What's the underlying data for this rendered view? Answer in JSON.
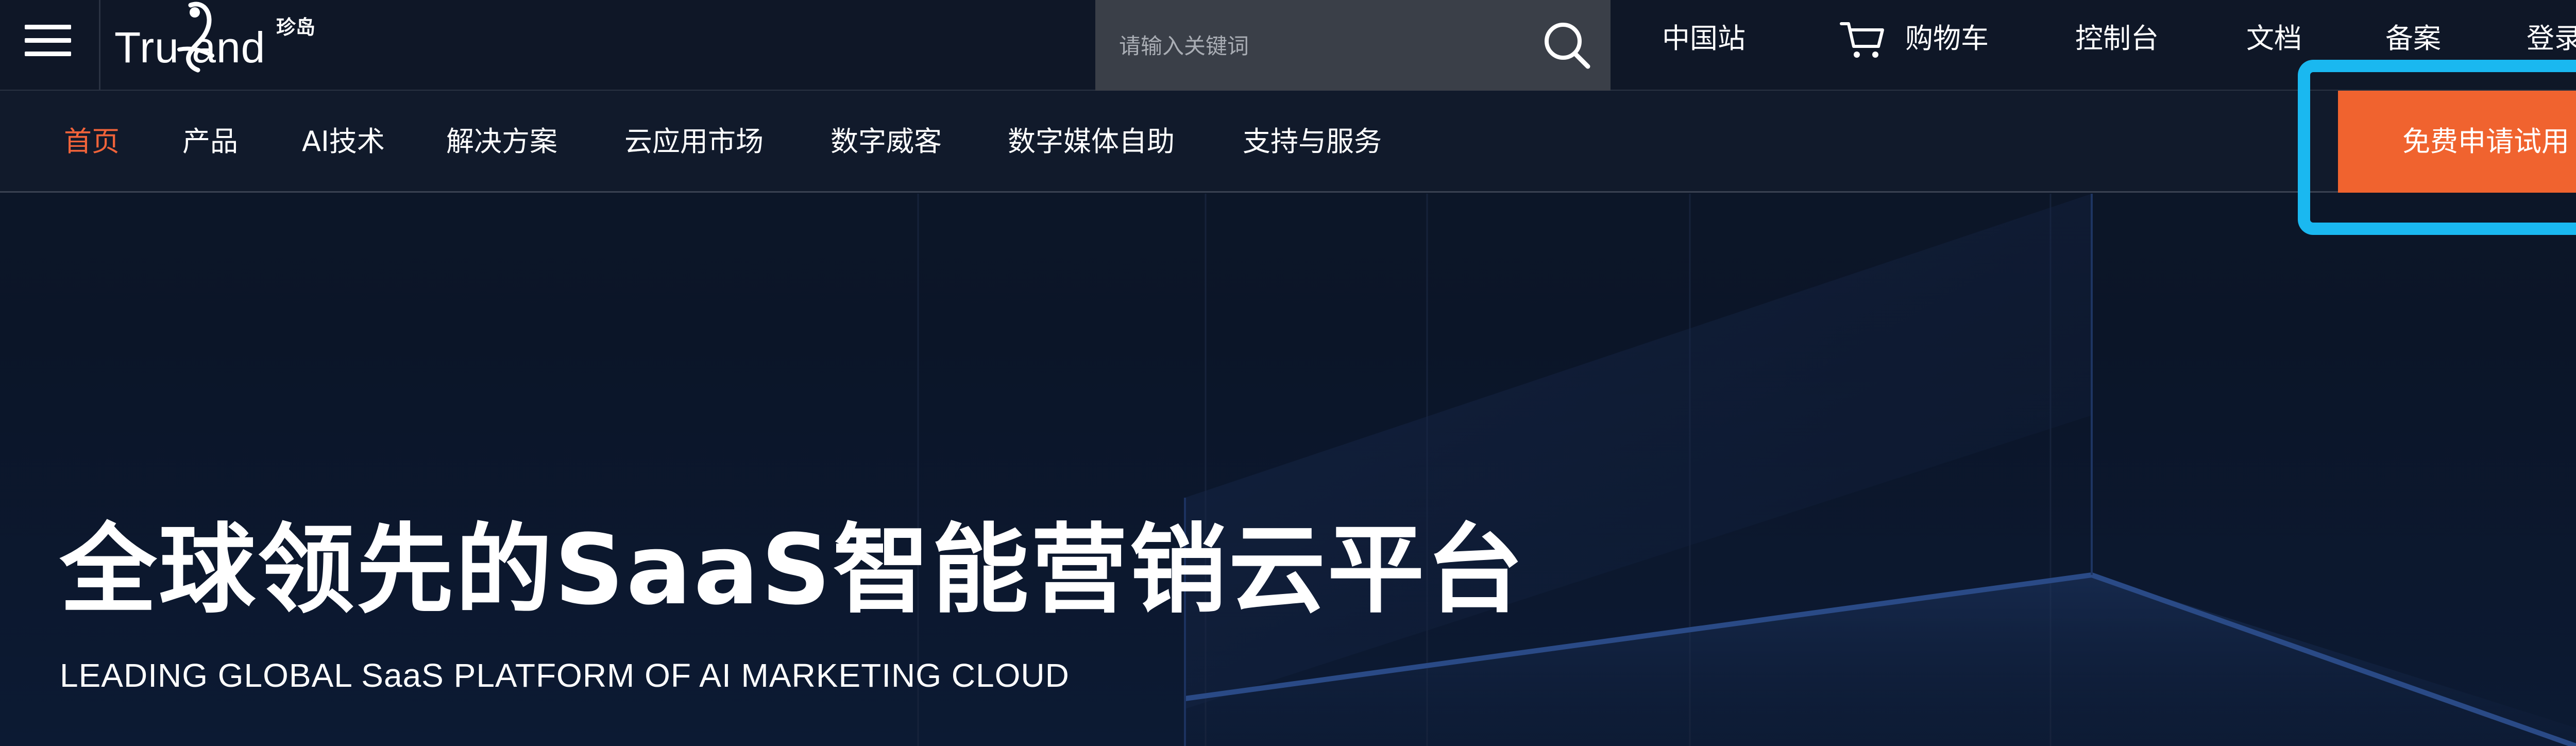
{
  "logo": {
    "text": "Tru  and",
    "cn": "珍岛"
  },
  "search": {
    "placeholder": "请输入关键词",
    "icon": "search-icon"
  },
  "top_links": {
    "region": "中国站",
    "cart": "购物车",
    "console": "控制台",
    "docs": "文档",
    "filing": "备案",
    "login": "登录"
  },
  "nav": {
    "items": [
      {
        "label": "首页",
        "active": true
      },
      {
        "label": "产品"
      },
      {
        "label": "AI技术"
      },
      {
        "label": "解决方案"
      },
      {
        "label": "云应用市场"
      },
      {
        "label": "数字威客"
      },
      {
        "label": "数字媒体自助"
      },
      {
        "label": "支持与服务"
      }
    ],
    "cta_label": "免费申请试用"
  },
  "hero": {
    "title": "全球领先的SaaS智能营销云平台",
    "subtitle": "LEADING GLOBAL SaaS PLATFORM OF AI MARKETING CLOUD"
  },
  "colors": {
    "accent": "#f0632f",
    "active_nav": "#f0633a",
    "highlight": "#1ab8f0",
    "background": "#0b1424"
  }
}
